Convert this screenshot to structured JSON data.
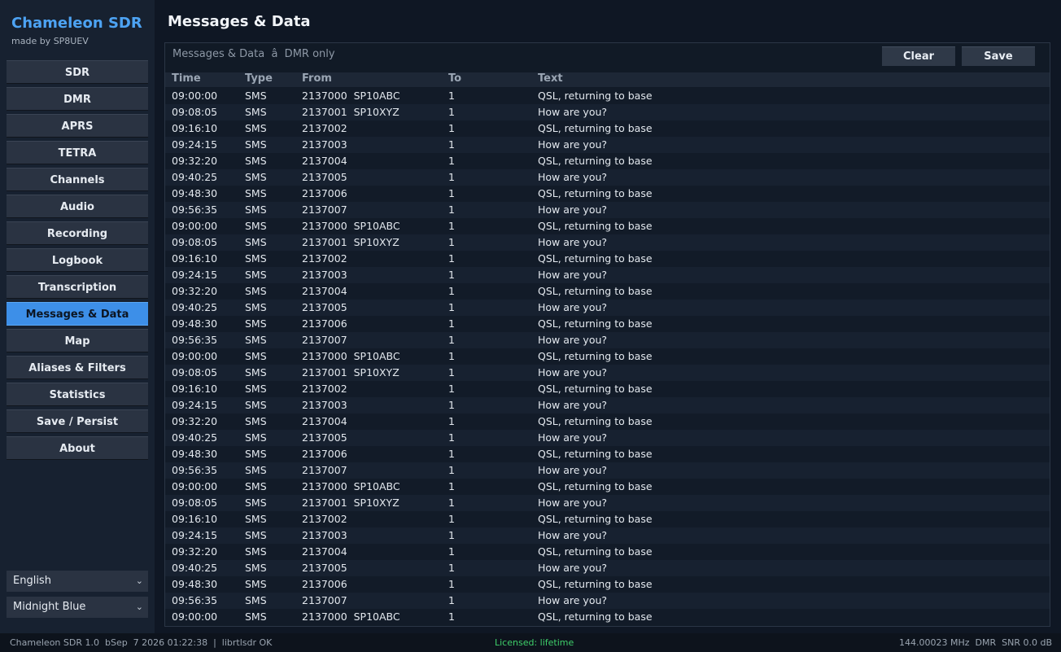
{
  "app": {
    "title": "Chameleon SDR",
    "subtitle": "made by SP8UEV"
  },
  "nav": [
    {
      "label": "SDR",
      "active": false
    },
    {
      "label": "DMR",
      "active": false
    },
    {
      "label": "APRS",
      "active": false
    },
    {
      "label": "TETRA",
      "active": false
    },
    {
      "label": "Channels",
      "active": false
    },
    {
      "label": "Audio",
      "active": false
    },
    {
      "label": "Recording",
      "active": false
    },
    {
      "label": "Logbook",
      "active": false
    },
    {
      "label": "Transcription",
      "active": false
    },
    {
      "label": "Messages & Data",
      "active": true
    },
    {
      "label": "Map",
      "active": false
    },
    {
      "label": "Aliases & Filters",
      "active": false
    },
    {
      "label": "Statistics",
      "active": false
    },
    {
      "label": "Save / Persist",
      "active": false
    },
    {
      "label": "About",
      "active": false
    }
  ],
  "selects": {
    "language": "English",
    "theme": "Midnight Blue"
  },
  "page": {
    "title": "Messages & Data",
    "caption": "Messages & Data  â  DMR only",
    "clear_label": "Clear",
    "save_label": "Save"
  },
  "table": {
    "columns": {
      "time": "Time",
      "type": "Type",
      "from": "From",
      "to": "To",
      "text": "Text"
    },
    "rows": [
      {
        "time": "09:00:00",
        "type": "SMS",
        "from": "2137000  SP10ABC",
        "to": "1",
        "text": "QSL, returning to base"
      },
      {
        "time": "09:08:05",
        "type": "SMS",
        "from": "2137001  SP10XYZ",
        "to": "1",
        "text": "How are you?"
      },
      {
        "time": "09:16:10",
        "type": "SMS",
        "from": "2137002",
        "to": "1",
        "text": "QSL, returning to base"
      },
      {
        "time": "09:24:15",
        "type": "SMS",
        "from": "2137003",
        "to": "1",
        "text": "How are you?"
      },
      {
        "time": "09:32:20",
        "type": "SMS",
        "from": "2137004",
        "to": "1",
        "text": "QSL, returning to base"
      },
      {
        "time": "09:40:25",
        "type": "SMS",
        "from": "2137005",
        "to": "1",
        "text": "How are you?"
      },
      {
        "time": "09:48:30",
        "type": "SMS",
        "from": "2137006",
        "to": "1",
        "text": "QSL, returning to base"
      },
      {
        "time": "09:56:35",
        "type": "SMS",
        "from": "2137007",
        "to": "1",
        "text": "How are you?"
      },
      {
        "time": "09:00:00",
        "type": "SMS",
        "from": "2137000  SP10ABC",
        "to": "1",
        "text": "QSL, returning to base"
      },
      {
        "time": "09:08:05",
        "type": "SMS",
        "from": "2137001  SP10XYZ",
        "to": "1",
        "text": "How are you?"
      },
      {
        "time": "09:16:10",
        "type": "SMS",
        "from": "2137002",
        "to": "1",
        "text": "QSL, returning to base"
      },
      {
        "time": "09:24:15",
        "type": "SMS",
        "from": "2137003",
        "to": "1",
        "text": "How are you?"
      },
      {
        "time": "09:32:20",
        "type": "SMS",
        "from": "2137004",
        "to": "1",
        "text": "QSL, returning to base"
      },
      {
        "time": "09:40:25",
        "type": "SMS",
        "from": "2137005",
        "to": "1",
        "text": "How are you?"
      },
      {
        "time": "09:48:30",
        "type": "SMS",
        "from": "2137006",
        "to": "1",
        "text": "QSL, returning to base"
      },
      {
        "time": "09:56:35",
        "type": "SMS",
        "from": "2137007",
        "to": "1",
        "text": "How are you?"
      },
      {
        "time": "09:00:00",
        "type": "SMS",
        "from": "2137000  SP10ABC",
        "to": "1",
        "text": "QSL, returning to base"
      },
      {
        "time": "09:08:05",
        "type": "SMS",
        "from": "2137001  SP10XYZ",
        "to": "1",
        "text": "How are you?"
      },
      {
        "time": "09:16:10",
        "type": "SMS",
        "from": "2137002",
        "to": "1",
        "text": "QSL, returning to base"
      },
      {
        "time": "09:24:15",
        "type": "SMS",
        "from": "2137003",
        "to": "1",
        "text": "How are you?"
      },
      {
        "time": "09:32:20",
        "type": "SMS",
        "from": "2137004",
        "to": "1",
        "text": "QSL, returning to base"
      },
      {
        "time": "09:40:25",
        "type": "SMS",
        "from": "2137005",
        "to": "1",
        "text": "How are you?"
      },
      {
        "time": "09:48:30",
        "type": "SMS",
        "from": "2137006",
        "to": "1",
        "text": "QSL, returning to base"
      },
      {
        "time": "09:56:35",
        "type": "SMS",
        "from": "2137007",
        "to": "1",
        "text": "How are you?"
      },
      {
        "time": "09:00:00",
        "type": "SMS",
        "from": "2137000  SP10ABC",
        "to": "1",
        "text": "QSL, returning to base"
      },
      {
        "time": "09:08:05",
        "type": "SMS",
        "from": "2137001  SP10XYZ",
        "to": "1",
        "text": "How are you?"
      },
      {
        "time": "09:16:10",
        "type": "SMS",
        "from": "2137002",
        "to": "1",
        "text": "QSL, returning to base"
      },
      {
        "time": "09:24:15",
        "type": "SMS",
        "from": "2137003",
        "to": "1",
        "text": "How are you?"
      },
      {
        "time": "09:32:20",
        "type": "SMS",
        "from": "2137004",
        "to": "1",
        "text": "QSL, returning to base"
      },
      {
        "time": "09:40:25",
        "type": "SMS",
        "from": "2137005",
        "to": "1",
        "text": "How are you?"
      },
      {
        "time": "09:48:30",
        "type": "SMS",
        "from": "2137006",
        "to": "1",
        "text": "QSL, returning to base"
      },
      {
        "time": "09:56:35",
        "type": "SMS",
        "from": "2137007",
        "to": "1",
        "text": "How are you?"
      },
      {
        "time": "09:00:00",
        "type": "SMS",
        "from": "2137000  SP10ABC",
        "to": "1",
        "text": "QSL, returning to base"
      }
    ]
  },
  "status": {
    "left": "Chameleon SDR 1.0  bSep  7 2026 01:22:38  |  librtlsdr OK",
    "license": "Licensed: lifetime",
    "right": "144.00023 MHz  DMR  SNR 0.0 dB"
  },
  "icons": {
    "dropdown": "chevron-down-icon"
  },
  "colors": {
    "accent": "#3d8fe8",
    "brand": "#4da3f3",
    "license": "#3ecf6a"
  }
}
